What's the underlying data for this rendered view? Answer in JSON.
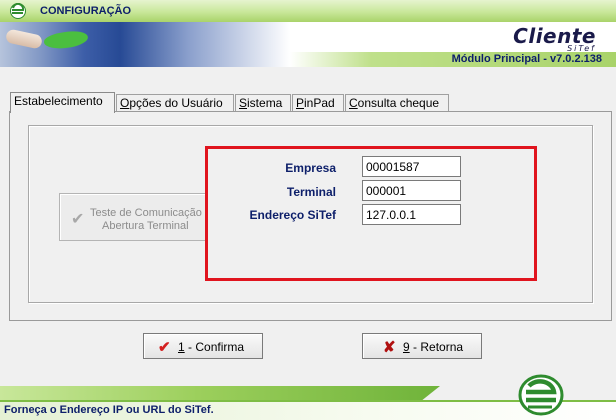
{
  "window": {
    "title": "CONFIGURAÇÃO",
    "brand": "Cliente",
    "brand_sub": "SiTef",
    "version": "Módulo Principal - v7.0.2.138"
  },
  "tabs": [
    {
      "label": "Estabelecimento",
      "active": true
    },
    {
      "label_pre": "O",
      "label_rest": "pções do Usuário"
    },
    {
      "label_pre": "S",
      "label_rest": "istema"
    },
    {
      "label_pre": "P",
      "label_rest": "inPad"
    },
    {
      "label_pre": "C",
      "label_rest": "onsulta cheque"
    }
  ],
  "test_button": {
    "line1": "Teste de Comunicação",
    "line2": "Abertura Terminal",
    "icon": "check-icon",
    "enabled": false
  },
  "fields": {
    "empresa": {
      "label": "Empresa",
      "value": "00001587"
    },
    "terminal": {
      "label": "Terminal",
      "value": "000001"
    },
    "endereco": {
      "label": "Endereço SiTef",
      "value": "127.0.0.1"
    }
  },
  "buttons": {
    "confirma": {
      "key": "1",
      "label": " - Confirma",
      "icon": "check-icon",
      "icon_color": "#d42020"
    },
    "retorna": {
      "key": "9",
      "label": " - Retorna",
      "icon": "x-icon",
      "icon_color": "#b01010"
    }
  },
  "status": "Forneça o Endereço IP ou URL do SiTef.",
  "colors": {
    "accent_green": "#a9d36a",
    "text_navy": "#0d1f6a",
    "highlight_red": "#e0141e"
  }
}
